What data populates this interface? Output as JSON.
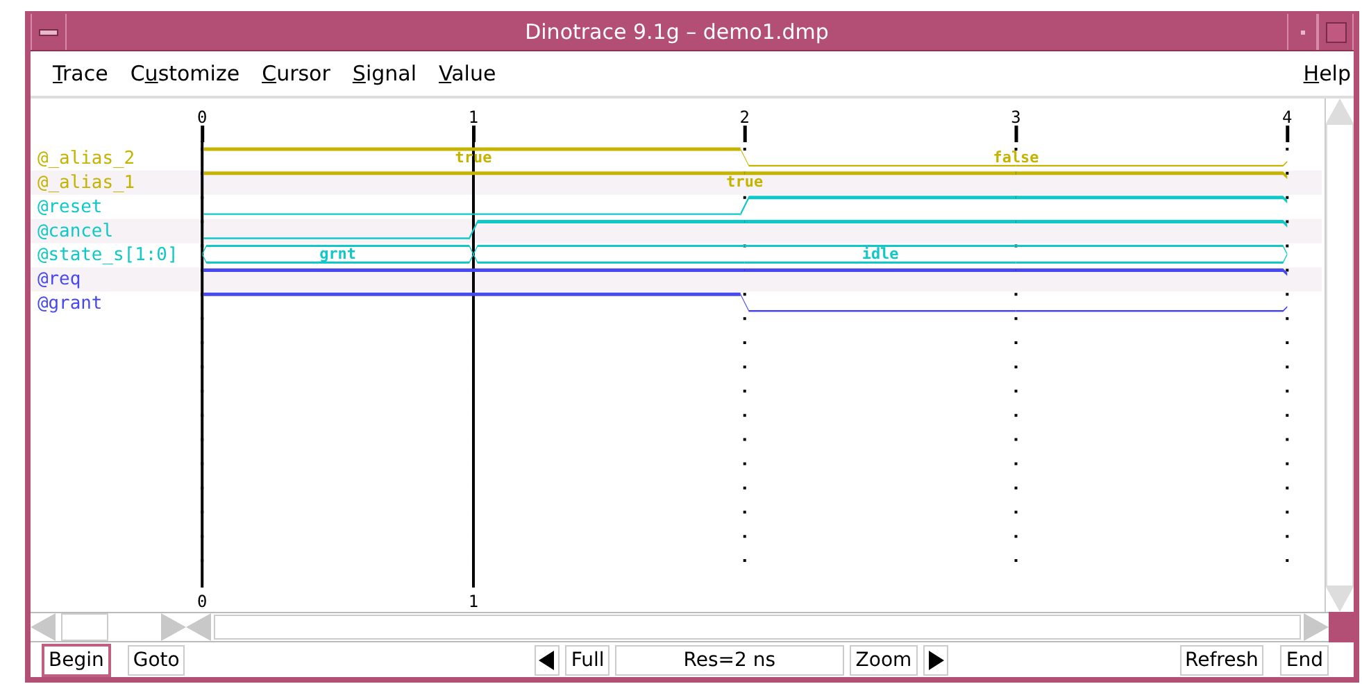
{
  "window": {
    "title": "Dinotrace 9.1g – demo1.dmp"
  },
  "menu": [
    {
      "mnemonic": "T",
      "after": "race"
    },
    {
      "before": "C",
      "mnemonic": "u",
      "after": "stomize"
    },
    {
      "mnemonic": "C",
      "after": "ursor"
    },
    {
      "mnemonic": "S",
      "after": "ignal"
    },
    {
      "mnemonic": "V",
      "after": "alue"
    }
  ],
  "help_menu": {
    "mnemonic": "H",
    "after": "elp"
  },
  "timescale": {
    "ticks": [
      "0",
      "1",
      "2",
      "3",
      "4"
    ]
  },
  "cursors": [
    {
      "time": "0"
    },
    {
      "time": "1"
    }
  ],
  "signals": [
    {
      "name": "@_alias_2",
      "color": "#c4b400",
      "kind": "bit",
      "intervals": [
        {
          "transition": false,
          "high": true,
          "value": "true"
        },
        {
          "transition": false,
          "high": true
        },
        {
          "transition": true,
          "high": false,
          "value": "false"
        },
        {
          "transition": false,
          "high": false
        }
      ]
    },
    {
      "name": "@_alias_1",
      "color": "#c4b400",
      "kind": "bit",
      "intervals": [
        {
          "transition": false,
          "high": true,
          "value": "true"
        },
        {
          "transition": false,
          "high": true
        },
        {
          "transition": false,
          "high": true
        },
        {
          "transition": false,
          "high": true
        }
      ]
    },
    {
      "name": "@reset",
      "color": "#10c8c8",
      "kind": "bit",
      "intervals": [
        {
          "transition": false,
          "high": false
        },
        {
          "transition": false,
          "high": false
        },
        {
          "transition": true,
          "high": true
        },
        {
          "transition": false,
          "high": true
        }
      ]
    },
    {
      "name": "@cancel",
      "color": "#10c8c8",
      "kind": "bit",
      "intervals": [
        {
          "transition": false,
          "high": false
        },
        {
          "transition": true,
          "high": true
        },
        {
          "transition": false,
          "high": true
        },
        {
          "transition": false,
          "high": true
        }
      ]
    },
    {
      "name": "@state_s[1:0]",
      "color": "#10c8c8",
      "kind": "bus",
      "intervals": [
        {
          "transition": true,
          "value": "grnt"
        },
        {
          "transition": true,
          "value": "idle"
        },
        {
          "transition": false
        },
        {
          "transition": false
        }
      ]
    },
    {
      "name": "@req",
      "color": "#4848f0",
      "kind": "bit",
      "intervals": [
        {
          "transition": false,
          "high": true
        },
        {
          "transition": false,
          "high": true
        },
        {
          "transition": false,
          "high": true
        },
        {
          "transition": false,
          "high": true
        }
      ]
    },
    {
      "name": "@grant",
      "color": "#4848f0",
      "kind": "bit",
      "intervals": [
        {
          "transition": false,
          "high": true
        },
        {
          "transition": false,
          "high": true
        },
        {
          "transition": true,
          "high": false
        },
        {
          "transition": false,
          "high": false
        }
      ]
    }
  ],
  "toolbar": {
    "left": [
      {
        "label": "Begin",
        "focused": true
      },
      {
        "label": "Goto",
        "focused": false
      }
    ],
    "full": "Full",
    "resolution": "Res=2 ns",
    "zoom": "Zoom",
    "right": [
      {
        "label": "Refresh",
        "focused": false
      },
      {
        "label": "End",
        "focused": false
      }
    ]
  }
}
